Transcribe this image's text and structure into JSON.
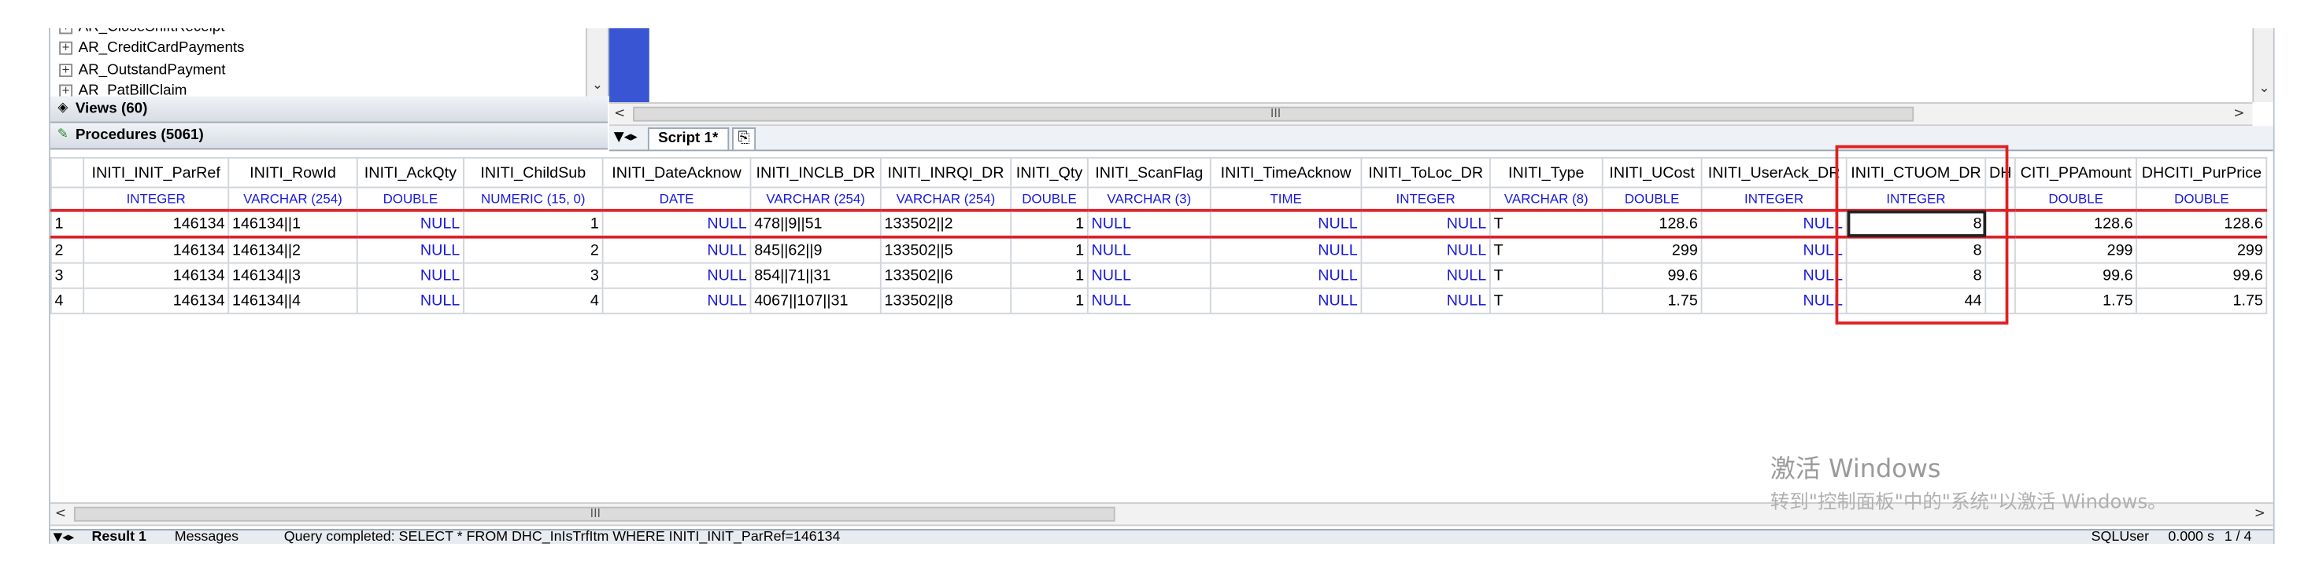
{
  "object_tree": {
    "items": [
      "AR_CloseShiftReceipt",
      "AR_CreditCardPayments",
      "AR_OutstandPayment",
      "AR_PatBillClaim"
    ],
    "views_label": "Views",
    "views_count": "(60)",
    "procedures_label": "Procedures",
    "procedures_count": "(5061)"
  },
  "editor_tabs": {
    "script_tab": "Script 1*"
  },
  "grid": {
    "columns": [
      {
        "name": "INITI_INIT_ParRef",
        "type": "INTEGER"
      },
      {
        "name": "INITI_RowId",
        "type": "VARCHAR (254)"
      },
      {
        "name": "INITI_AckQty",
        "type": "DOUBLE"
      },
      {
        "name": "INITI_ChildSub",
        "type": "NUMERIC (15, 0)"
      },
      {
        "name": "INITI_DateAcknow",
        "type": "DATE"
      },
      {
        "name": "INITI_INCLB_DR",
        "type": "VARCHAR (254)"
      },
      {
        "name": "INITI_INRQI_DR",
        "type": "VARCHAR (254)"
      },
      {
        "name": "INITI_Qty",
        "type": "DOUBLE"
      },
      {
        "name": "INITI_ScanFlag",
        "type": "VARCHAR (3)"
      },
      {
        "name": "INITI_TimeAcknow",
        "type": "TIME"
      },
      {
        "name": "INITI_ToLoc_DR",
        "type": "INTEGER"
      },
      {
        "name": "INITI_Type",
        "type": "VARCHAR (8)"
      },
      {
        "name": "INITI_UCost",
        "type": "DOUBLE"
      },
      {
        "name": "INITI_UserAck_DR",
        "type": "INTEGER"
      },
      {
        "name": "INITI_CTUOM_DR",
        "type": "INTEGER"
      },
      {
        "name": "DH",
        "type": ""
      },
      {
        "name": "CITI_PPAmount",
        "type": "DOUBLE"
      },
      {
        "name": "DHCITI_PurPrice",
        "type": "DOUBLE"
      }
    ],
    "rows": [
      [
        "1",
        "146134",
        "146134||1",
        "NULL",
        "1",
        "NULL",
        "478||9||51",
        "133502||2",
        "1",
        "NULL",
        "NULL",
        "NULL",
        "T",
        "128.6",
        "NULL",
        "8",
        "",
        "128.6",
        "128.6"
      ],
      [
        "2",
        "146134",
        "146134||2",
        "NULL",
        "2",
        "NULL",
        "845||62||9",
        "133502||5",
        "1",
        "NULL",
        "NULL",
        "NULL",
        "T",
        "299",
        "NULL",
        "8",
        "",
        "299",
        "299"
      ],
      [
        "3",
        "146134",
        "146134||3",
        "NULL",
        "3",
        "NULL",
        "854||71||31",
        "133502||6",
        "1",
        "NULL",
        "NULL",
        "NULL",
        "T",
        "99.6",
        "NULL",
        "8",
        "",
        "99.6",
        "99.6"
      ],
      [
        "4",
        "146134",
        "146134||4",
        "NULL",
        "4",
        "NULL",
        "4067||107||31",
        "133502||8",
        "1",
        "NULL",
        "NULL",
        "NULL",
        "T",
        "1.75",
        "NULL",
        "44",
        "",
        "1.75",
        "1.75"
      ]
    ]
  },
  "scroll": {
    "grip": "III"
  },
  "bottom_bar": {
    "result_tab": "Result 1",
    "messages_tab": "Messages",
    "status_text": "Query completed: SELECT * FROM DHC_InIsTrfItm WHERE INITI_INIT_ParRef=146134",
    "user": "SQLUser",
    "time": "0.000 s",
    "position": "1 / 4"
  },
  "watermark": {
    "line1": "激活 Windows",
    "line2": "转到\"控制面板\"中的\"系统\"以激活 Windows。"
  },
  "colors": {
    "accent_blue": "#3a55d4",
    "null_text": "#1a1adf",
    "highlight_red": "#e02020"
  }
}
